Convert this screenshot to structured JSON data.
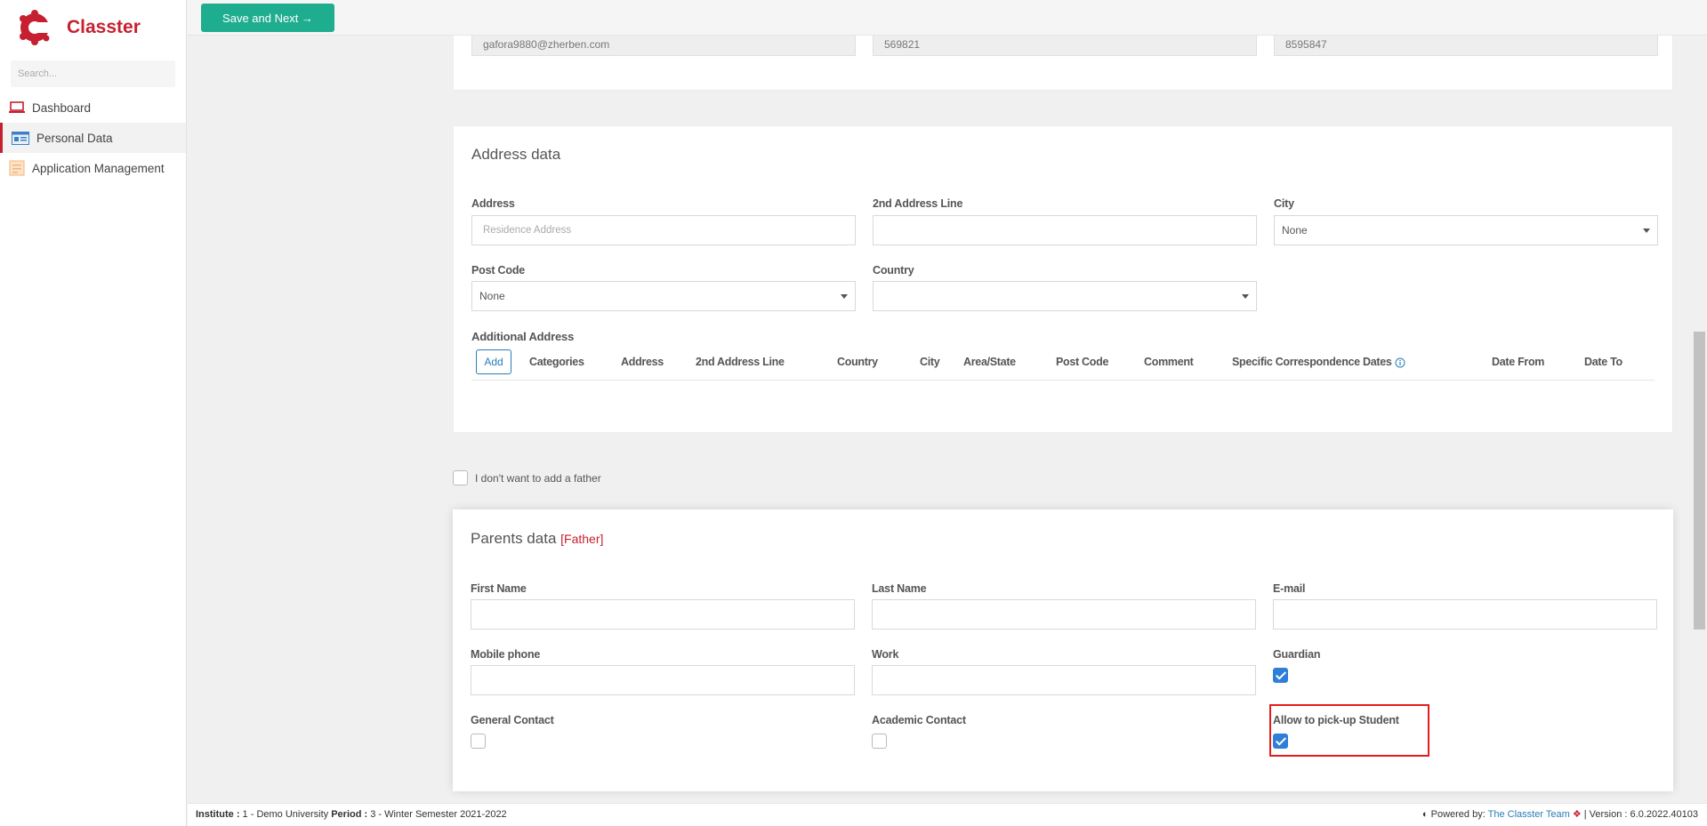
{
  "app": {
    "name": "Classter",
    "brand_color": "#c62030"
  },
  "sidebar": {
    "search_placeholder": "Search...",
    "items": [
      {
        "label": "Dashboard",
        "icon": "laptop-icon"
      },
      {
        "label": "Personal Data",
        "icon": "id-card-icon",
        "active": true
      },
      {
        "label": "Application Management",
        "icon": "application-icon"
      }
    ]
  },
  "toolbar": {
    "save_next_label": "Save and Next →",
    "accent": "#1fad8f"
  },
  "contact_readonly": {
    "email": "gafora9880@zherben.com",
    "field2": "569821",
    "field3": "8595847"
  },
  "address": {
    "title": "Address data",
    "address_label": "Address",
    "address_placeholder": "Residence Address",
    "line2_label": "2nd Address Line",
    "line2_value": "",
    "city_label": "City",
    "city_value": "None",
    "postcode_label": "Post Code",
    "postcode_value": "None",
    "country_label": "Country",
    "country_value": "",
    "additional_label": "Additional Address",
    "add_button": "Add",
    "columns": [
      "Categories",
      "Address",
      "2nd Address Line",
      "Country",
      "City",
      "Area/State",
      "Post Code",
      "Comment",
      "Specific Correspondence Dates",
      "Date From",
      "Date To"
    ]
  },
  "no_father_label": "I don't want to add a father",
  "parents": {
    "title": "Parents data",
    "tag": "[Father]",
    "first_name_label": "First Name",
    "last_name_label": "Last Name",
    "email_label": "E-mail",
    "mobile_label": "Mobile phone",
    "work_label": "Work",
    "guardian_label": "Guardian",
    "guardian_checked": true,
    "general_contact_label": "General Contact",
    "general_contact_checked": false,
    "academic_contact_label": "Academic Contact",
    "academic_contact_checked": false,
    "pickup_label": "Allow to pick-up Student",
    "pickup_checked": true
  },
  "footer": {
    "institute_label": "Institute :",
    "institute_value": " 1 - Demo University ",
    "period_label": "Period :",
    "period_value": " 3 - Winter Semester 2021-2022",
    "powered_by": "Powered by:",
    "team": "The Classter Team",
    "version": "| Version : 6.0.2022.40103"
  }
}
